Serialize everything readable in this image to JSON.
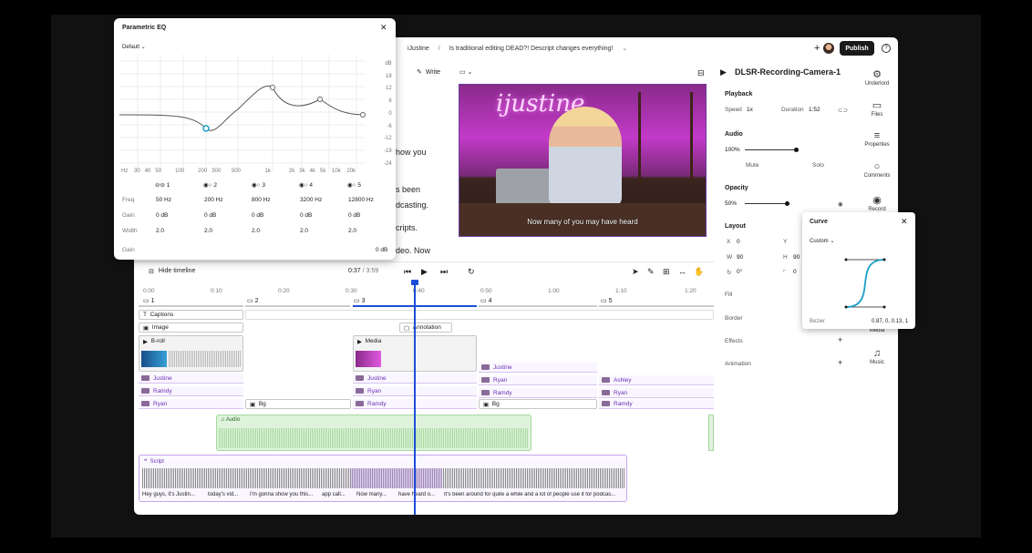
{
  "topbar": {
    "breadcrumb_project": "iJustine",
    "breadcrumb_sep": "/",
    "breadcrumb_title": "Is traditional editing DEAD?! Descript changes everything!",
    "publish_label": "Publish"
  },
  "toolbar": {
    "write_label": "Write"
  },
  "video": {
    "neon_text": "ijustine",
    "caption": "Now many of you may have heard"
  },
  "script_fragments": [
    "how you",
    "s been",
    "dcasting.",
    "cripts.",
    "deo. Now"
  ],
  "right_panel": {
    "title": "DLSR-Recording-Camera-1",
    "playback": {
      "heading": "Playback",
      "speed_label": "Speed",
      "speed_value": "1x",
      "duration_label": "Duration",
      "duration_value": "1:52"
    },
    "audio": {
      "heading": "Audio",
      "volume": "100%",
      "mute": "Mute",
      "solo": "Solo"
    },
    "opacity": {
      "heading": "Opacity",
      "value": "50%"
    },
    "layout": {
      "heading": "Layout",
      "x_label": "X",
      "x_value": "0",
      "y_label": "Y",
      "y_value": "0",
      "w_label": "W",
      "w_value": "90",
      "h_label": "H",
      "h_value": "90",
      "r_value": "0°",
      "r2_value": "0"
    },
    "fill": "Fill",
    "border": "Border",
    "effects": "Effects",
    "animation": "Animation"
  },
  "sidebar": [
    {
      "label": "Underlord",
      "icon": "robot-icon"
    },
    {
      "label": "Files",
      "icon": "folder-icon"
    },
    {
      "label": "Properties",
      "icon": "sliders-icon"
    },
    {
      "label": "Comments",
      "icon": "comment-icon"
    },
    {
      "label": "Record",
      "icon": "record-icon"
    },
    {
      "label": "Media",
      "icon": "media-icon"
    },
    {
      "label": "Music",
      "icon": "music-icon"
    }
  ],
  "timeline": {
    "hide_label": "Hide timeline",
    "time_current": "0:37",
    "time_sep": "/",
    "time_total": "3:59",
    "ruler": [
      "0:00",
      "0:10",
      "0:20",
      "0:30",
      "0:40",
      "0:50",
      "1:00",
      "1:10",
      "1:20"
    ],
    "scenes": [
      "1",
      "2",
      "3",
      "4",
      "5"
    ],
    "tracks": {
      "captions": "Captions",
      "image": "Image",
      "annotation": "Annotation",
      "broll": "B-roll",
      "media": "Media",
      "bg": "Bg",
      "audio": "Audio",
      "script": "Script"
    },
    "people": {
      "justine": "Justine",
      "ryan": "Ryan",
      "ramdy": "Ramdy",
      "ashley": "Ashley"
    },
    "script_words": [
      "Hey guys, it's Justin...",
      "today's vid...",
      "I'm gonna show you this...",
      "app call...",
      "Now many...",
      "have heard o...",
      "It's been around for quite a while and a lot of people use it for podcas..."
    ]
  },
  "eq": {
    "title": "Parametric EQ",
    "preset": "Default",
    "db_labels": [
      "dB",
      "18",
      "12",
      "6",
      "0",
      "-6",
      "-12",
      "-18",
      "-24"
    ],
    "freq_axis": [
      "Hz",
      "30",
      "40",
      "50",
      "100",
      "200",
      "300",
      "500",
      "1k",
      "2k",
      "3k",
      "4k",
      "5k",
      "10k",
      "20k"
    ],
    "row_labels": [
      "Freq",
      "Gain",
      "Width"
    ],
    "bands": [
      {
        "num": "1",
        "freq": "50 Hz",
        "gain": "0 dB",
        "width": "2.0"
      },
      {
        "num": "2",
        "freq": "200 Hz",
        "gain": "0 dB",
        "width": "2.0"
      },
      {
        "num": "3",
        "freq": "800 Hz",
        "gain": "0 dB",
        "width": "2.0"
      },
      {
        "num": "4",
        "freq": "3200 Hz",
        "gain": "0 dB",
        "width": "2.0"
      },
      {
        "num": "5",
        "freq": "12800 Hz",
        "gain": "0 dB",
        "width": "2.0"
      }
    ],
    "gain_label": "Gain",
    "gain_value": "0 dB"
  },
  "curve": {
    "title": "Curve",
    "preset": "Custom",
    "type_label": "Bezier",
    "values": "0.87, 0, 0.13, 1"
  }
}
